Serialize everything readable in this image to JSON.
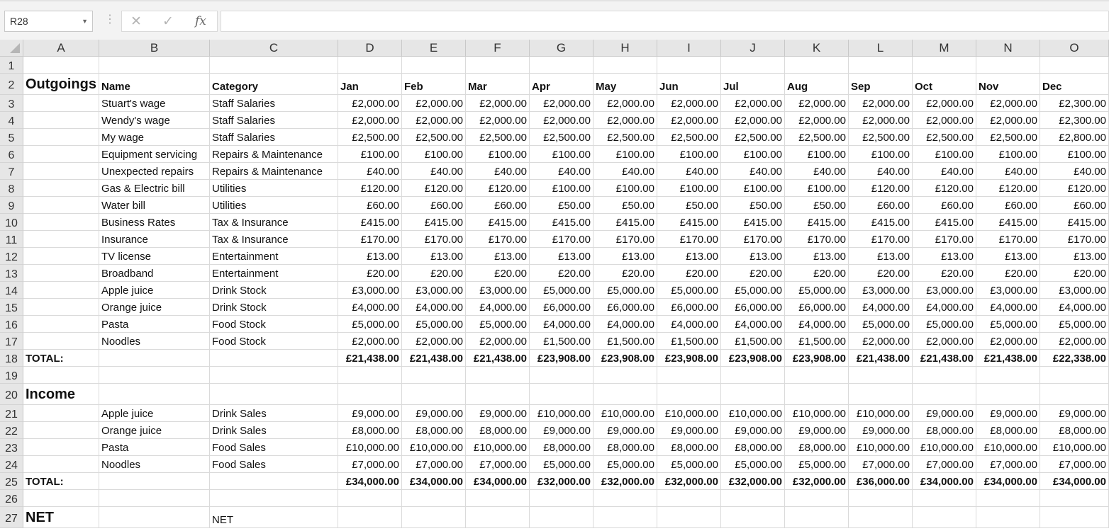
{
  "formula_bar": {
    "name_box": "R28",
    "cancel_icon": "✕",
    "enter_icon": "✓",
    "function_icon": "fx",
    "formula": ""
  },
  "columns": [
    "A",
    "B",
    "C",
    "D",
    "E",
    "F",
    "G",
    "H",
    "I",
    "J",
    "K",
    "L",
    "M",
    "N",
    "O"
  ],
  "rows": [
    {
      "n": "1",
      "cells": [
        "",
        "",
        "",
        "",
        "",
        "",
        "",
        "",
        "",
        "",
        "",
        "",
        "",
        "",
        ""
      ]
    },
    {
      "n": "2",
      "cells": [
        "Outgoings",
        "Name",
        "Category",
        "Jan",
        "Feb",
        "Mar",
        "Apr",
        "May",
        "Jun",
        "Jul",
        "Aug",
        "Sep",
        "Oct",
        "Nov",
        "Dec"
      ]
    },
    {
      "n": "3",
      "cells": [
        "",
        "Stuart's wage",
        "Staff Salaries",
        "£2,000.00",
        "£2,000.00",
        "£2,000.00",
        "£2,000.00",
        "£2,000.00",
        "£2,000.00",
        "£2,000.00",
        "£2,000.00",
        "£2,000.00",
        "£2,000.00",
        "£2,000.00",
        "£2,300.00"
      ]
    },
    {
      "n": "4",
      "cells": [
        "",
        "Wendy's wage",
        "Staff Salaries",
        "£2,000.00",
        "£2,000.00",
        "£2,000.00",
        "£2,000.00",
        "£2,000.00",
        "£2,000.00",
        "£2,000.00",
        "£2,000.00",
        "£2,000.00",
        "£2,000.00",
        "£2,000.00",
        "£2,300.00"
      ]
    },
    {
      "n": "5",
      "cells": [
        "",
        "My wage",
        "Staff Salaries",
        "£2,500.00",
        "£2,500.00",
        "£2,500.00",
        "£2,500.00",
        "£2,500.00",
        "£2,500.00",
        "£2,500.00",
        "£2,500.00",
        "£2,500.00",
        "£2,500.00",
        "£2,500.00",
        "£2,800.00"
      ]
    },
    {
      "n": "6",
      "cells": [
        "",
        "Equipment servicing",
        "Repairs & Maintenance",
        "£100.00",
        "£100.00",
        "£100.00",
        "£100.00",
        "£100.00",
        "£100.00",
        "£100.00",
        "£100.00",
        "£100.00",
        "£100.00",
        "£100.00",
        "£100.00"
      ]
    },
    {
      "n": "7",
      "cells": [
        "",
        "Unexpected repairs",
        "Repairs & Maintenance",
        "£40.00",
        "£40.00",
        "£40.00",
        "£40.00",
        "£40.00",
        "£40.00",
        "£40.00",
        "£40.00",
        "£40.00",
        "£40.00",
        "£40.00",
        "£40.00"
      ]
    },
    {
      "n": "8",
      "cells": [
        "",
        "Gas & Electric bill",
        "Utilities",
        "£120.00",
        "£120.00",
        "£120.00",
        "£100.00",
        "£100.00",
        "£100.00",
        "£100.00",
        "£100.00",
        "£120.00",
        "£120.00",
        "£120.00",
        "£120.00"
      ]
    },
    {
      "n": "9",
      "cells": [
        "",
        "Water bill",
        "Utilities",
        "£60.00",
        "£60.00",
        "£60.00",
        "£50.00",
        "£50.00",
        "£50.00",
        "£50.00",
        "£50.00",
        "£60.00",
        "£60.00",
        "£60.00",
        "£60.00"
      ]
    },
    {
      "n": "10",
      "cells": [
        "",
        "Business Rates",
        "Tax & Insurance",
        "£415.00",
        "£415.00",
        "£415.00",
        "£415.00",
        "£415.00",
        "£415.00",
        "£415.00",
        "£415.00",
        "£415.00",
        "£415.00",
        "£415.00",
        "£415.00"
      ]
    },
    {
      "n": "11",
      "cells": [
        "",
        "Insurance",
        "Tax & Insurance",
        "£170.00",
        "£170.00",
        "£170.00",
        "£170.00",
        "£170.00",
        "£170.00",
        "£170.00",
        "£170.00",
        "£170.00",
        "£170.00",
        "£170.00",
        "£170.00"
      ]
    },
    {
      "n": "12",
      "cells": [
        "",
        "TV license",
        "Entertainment",
        "£13.00",
        "£13.00",
        "£13.00",
        "£13.00",
        "£13.00",
        "£13.00",
        "£13.00",
        "£13.00",
        "£13.00",
        "£13.00",
        "£13.00",
        "£13.00"
      ]
    },
    {
      "n": "13",
      "cells": [
        "",
        "Broadband",
        "Entertainment",
        "£20.00",
        "£20.00",
        "£20.00",
        "£20.00",
        "£20.00",
        "£20.00",
        "£20.00",
        "£20.00",
        "£20.00",
        "£20.00",
        "£20.00",
        "£20.00"
      ]
    },
    {
      "n": "14",
      "cells": [
        "",
        "Apple juice",
        "Drink Stock",
        "£3,000.00",
        "£3,000.00",
        "£3,000.00",
        "£5,000.00",
        "£5,000.00",
        "£5,000.00",
        "£5,000.00",
        "£5,000.00",
        "£3,000.00",
        "£3,000.00",
        "£3,000.00",
        "£3,000.00"
      ]
    },
    {
      "n": "15",
      "cells": [
        "",
        "Orange juice",
        "Drink Stock",
        "£4,000.00",
        "£4,000.00",
        "£4,000.00",
        "£6,000.00",
        "£6,000.00",
        "£6,000.00",
        "£6,000.00",
        "£6,000.00",
        "£4,000.00",
        "£4,000.00",
        "£4,000.00",
        "£4,000.00"
      ]
    },
    {
      "n": "16",
      "cells": [
        "",
        "Pasta",
        "Food Stock",
        "£5,000.00",
        "£5,000.00",
        "£5,000.00",
        "£4,000.00",
        "£4,000.00",
        "£4,000.00",
        "£4,000.00",
        "£4,000.00",
        "£5,000.00",
        "£5,000.00",
        "£5,000.00",
        "£5,000.00"
      ]
    },
    {
      "n": "17",
      "cells": [
        "",
        "Noodles",
        "Food Stock",
        "£2,000.00",
        "£2,000.00",
        "£2,000.00",
        "£1,500.00",
        "£1,500.00",
        "£1,500.00",
        "£1,500.00",
        "£1,500.00",
        "£2,000.00",
        "£2,000.00",
        "£2,000.00",
        "£2,000.00"
      ]
    },
    {
      "n": "18",
      "cells": [
        "TOTAL:",
        "",
        "",
        "£21,438.00",
        "£21,438.00",
        "£21,438.00",
        "£23,908.00",
        "£23,908.00",
        "£23,908.00",
        "£23,908.00",
        "£23,908.00",
        "£21,438.00",
        "£21,438.00",
        "£21,438.00",
        "£22,338.00"
      ]
    },
    {
      "n": "19",
      "cells": [
        "",
        "",
        "",
        "",
        "",
        "",
        "",
        "",
        "",
        "",
        "",
        "",
        "",
        "",
        ""
      ]
    },
    {
      "n": "20",
      "cells": [
        "Income",
        "",
        "",
        "",
        "",
        "",
        "",
        "",
        "",
        "",
        "",
        "",
        "",
        "",
        ""
      ]
    },
    {
      "n": "21",
      "cells": [
        "",
        "Apple juice",
        "Drink Sales",
        "£9,000.00",
        "£9,000.00",
        "£9,000.00",
        "£10,000.00",
        "£10,000.00",
        "£10,000.00",
        "£10,000.00",
        "£10,000.00",
        "£10,000.00",
        "£9,000.00",
        "£9,000.00",
        "£9,000.00"
      ]
    },
    {
      "n": "22",
      "cells": [
        "",
        "Orange juice",
        "Drink Sales",
        "£8,000.00",
        "£8,000.00",
        "£8,000.00",
        "£9,000.00",
        "£9,000.00",
        "£9,000.00",
        "£9,000.00",
        "£9,000.00",
        "£9,000.00",
        "£8,000.00",
        "£8,000.00",
        "£8,000.00"
      ]
    },
    {
      "n": "23",
      "cells": [
        "",
        "Pasta",
        "Food Sales",
        "£10,000.00",
        "£10,000.00",
        "£10,000.00",
        "£8,000.00",
        "£8,000.00",
        "£8,000.00",
        "£8,000.00",
        "£8,000.00",
        "£10,000.00",
        "£10,000.00",
        "£10,000.00",
        "£10,000.00"
      ]
    },
    {
      "n": "24",
      "cells": [
        "",
        "Noodles",
        "Food Sales",
        "£7,000.00",
        "£7,000.00",
        "£7,000.00",
        "£5,000.00",
        "£5,000.00",
        "£5,000.00",
        "£5,000.00",
        "£5,000.00",
        "£7,000.00",
        "£7,000.00",
        "£7,000.00",
        "£7,000.00"
      ]
    },
    {
      "n": "25",
      "cells": [
        "TOTAL:",
        "",
        "",
        "£34,000.00",
        "£34,000.00",
        "£34,000.00",
        "£32,000.00",
        "£32,000.00",
        "£32,000.00",
        "£32,000.00",
        "£32,000.00",
        "£36,000.00",
        "£34,000.00",
        "£34,000.00",
        "£34,000.00"
      ]
    },
    {
      "n": "26",
      "cells": [
        "",
        "",
        "",
        "",
        "",
        "",
        "",
        "",
        "",
        "",
        "",
        "",
        "",
        "",
        ""
      ]
    },
    {
      "n": "27",
      "cells": [
        "NET",
        "",
        "NET",
        "",
        "",
        "",
        "",
        "",
        "",
        "",
        "",
        "",
        "",
        "",
        ""
      ]
    }
  ]
}
